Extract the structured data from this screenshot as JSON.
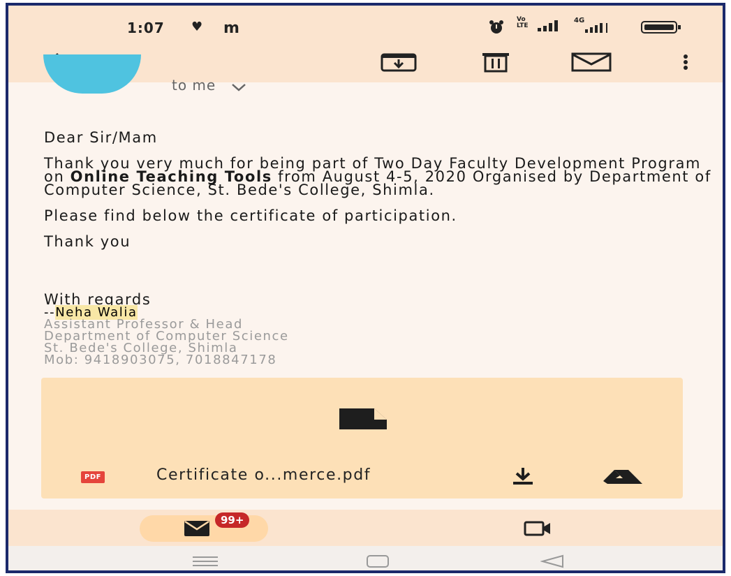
{
  "status_bar": {
    "time": "1:07",
    "notif_glyphs": [
      "♥",
      "m"
    ],
    "signal_labels": [
      "Vo LTE",
      "4G"
    ]
  },
  "toolbar": {
    "icons": [
      "back-arrow-icon",
      "archive-icon",
      "delete-icon",
      "mail-unread-icon",
      "more-vert-icon"
    ]
  },
  "email": {
    "to_me": "to me",
    "greeting": "Dear Sir/Mam",
    "para1_a": "Thank you very much for being part of Two Day Faculty Development Program on ",
    "para1_bold": "Online Teaching Tools",
    "para1_b": " from August 4-5, 2020 Organised by Department of Computer Science, St. Bede's College, Shimla.",
    "para2": "Please find below  the  certificate of participation.",
    "thanks": "Thank you",
    "regards": "With regards",
    "sig_prefix": "--",
    "sig_name": "Neha Walia",
    "sig_title": "Assistant Professor & Head",
    "sig_dept": "Department of Computer Science",
    "sig_college": "St. Bede's College, Shimla",
    "sig_mobile": "Mob: 9418903075, 7018847178"
  },
  "attachment": {
    "badge": "PDF",
    "file_name": "Certificate o...merce.pdf"
  },
  "bottom_nav": {
    "unread_badge": "99+"
  },
  "colors": {
    "accent_bar": "#fbe4cf",
    "attachment_bg": "#fde0b7",
    "badge_red": "#c62828",
    "avatar": "#4fc3e0"
  }
}
